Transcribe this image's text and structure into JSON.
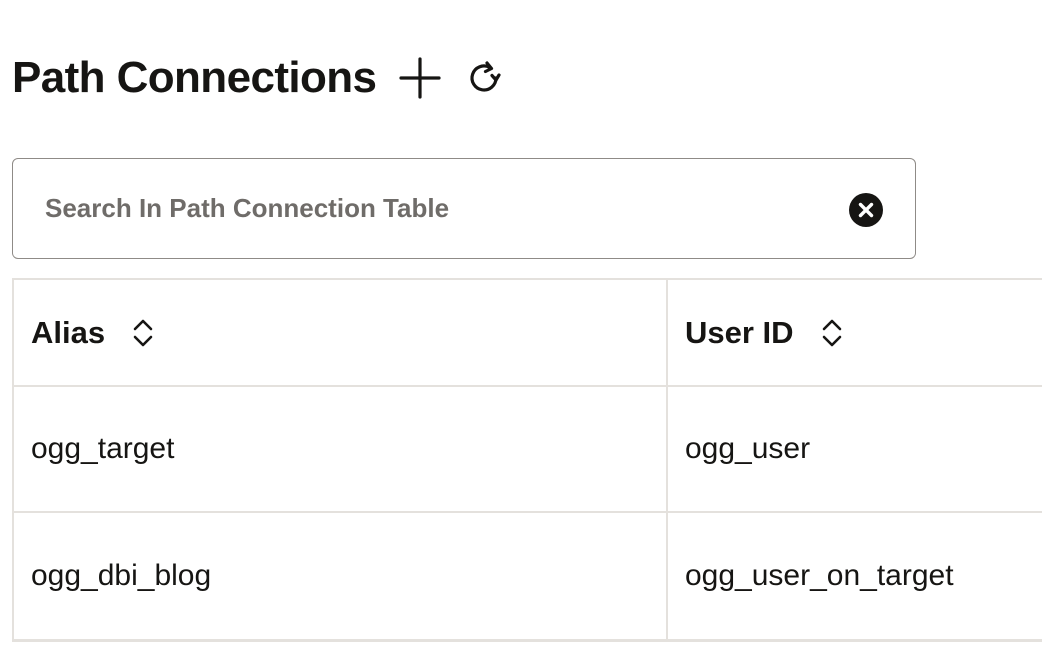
{
  "header": {
    "title": "Path Connections",
    "add_icon": "plus-icon",
    "refresh_icon": "refresh-icon"
  },
  "search": {
    "placeholder": "Search In Path Connection Table",
    "value": "",
    "clear_icon": "close-circle-icon"
  },
  "table": {
    "columns": [
      {
        "label": "Alias",
        "sort_icon": "sort-chevrons-icon"
      },
      {
        "label": "User ID",
        "sort_icon": "sort-chevrons-icon"
      }
    ],
    "rows": [
      {
        "alias": "ogg_target",
        "user_id": "ogg_user"
      },
      {
        "alias": "ogg_dbi_blog",
        "user_id": "ogg_user_on_target"
      }
    ]
  },
  "colors": {
    "text": "#161513",
    "border": "#e4e1dd",
    "input_border": "#8f8b87",
    "placeholder": "#6f6c69"
  }
}
